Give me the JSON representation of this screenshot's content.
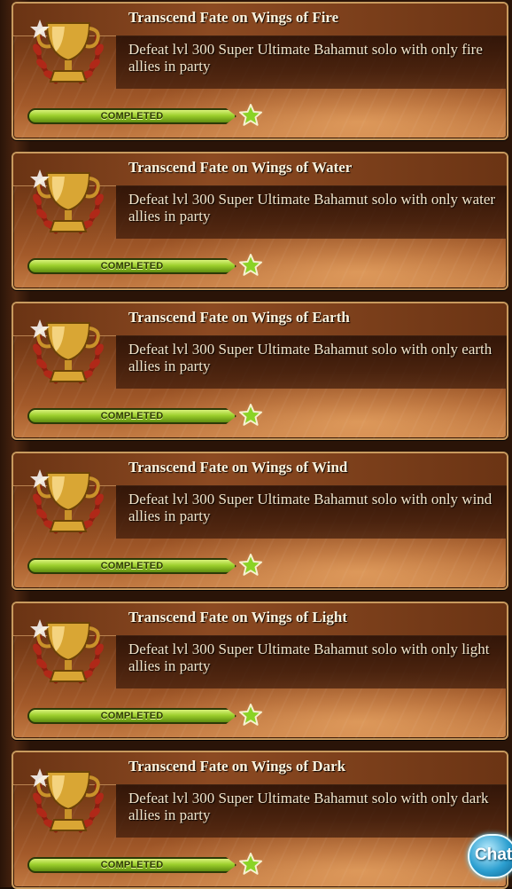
{
  "achievements": [
    {
      "title": "Transcend Fate on Wings of Fire",
      "description": "Defeat lvl 300 Super Ultimate Bahamut solo with only fire allies in party",
      "status": "COMPLETED",
      "progress": 1.0
    },
    {
      "title": "Transcend Fate on Wings of Water",
      "description": "Defeat lvl 300 Super Ultimate Bahamut solo with only water allies in party",
      "status": "COMPLETED",
      "progress": 1.0
    },
    {
      "title": "Transcend Fate on Wings of Earth",
      "description": "Defeat lvl 300 Super Ultimate Bahamut solo with only earth allies in party",
      "status": "COMPLETED",
      "progress": 1.0
    },
    {
      "title": "Transcend Fate on Wings of Wind",
      "description": "Defeat lvl 300 Super Ultimate Bahamut solo with only wind allies in party",
      "status": "COMPLETED",
      "progress": 1.0
    },
    {
      "title": "Transcend Fate on Wings of Light",
      "description": "Defeat lvl 300 Super Ultimate Bahamut solo with only light allies in party",
      "status": "COMPLETED",
      "progress": 1.0
    },
    {
      "title": "Transcend Fate on Wings of Dark",
      "description": "Defeat lvl 300 Super Ultimate Bahamut solo with only dark allies in party",
      "status": "COMPLETED",
      "progress": 1.0
    }
  ],
  "icons": {
    "trophy": "trophy-icon",
    "star": "star-icon"
  },
  "chat": {
    "label": "Chat"
  },
  "colors": {
    "progress_fill": "#9ccf2c",
    "title_text": "#fbf2dc",
    "card_border": "#c89a5e",
    "chat_button": "#2c9fd0"
  }
}
